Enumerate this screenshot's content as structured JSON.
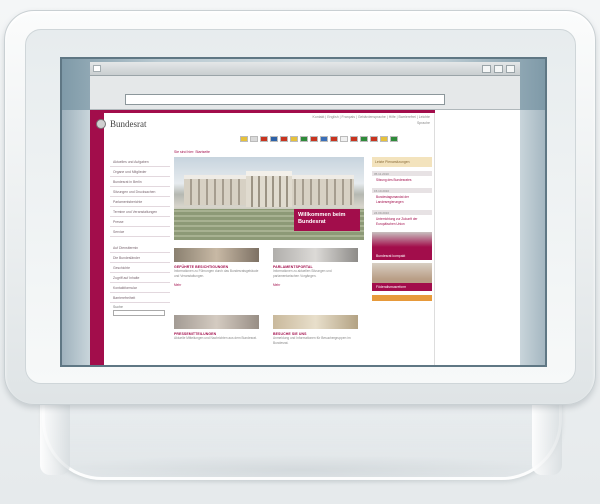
{
  "site": {
    "logo_text": "Bundesrat",
    "top_links": "Kontakt | English | Français | Gebärdensprache | Hilfe | Barrierefrei | Leichte Sprache",
    "breadcrumb": "Sie sind hier: Startseite",
    "nav_items": [
      "Aktuelles und Aufgaben",
      "Organe und Mitglieder",
      "Bundesrat in Berlin",
      "Sitzungen und Drucksachen",
      "Parlamentsberichte",
      "Termine und Veranstaltungen",
      "Presse",
      "Service"
    ],
    "nav_items_2": [
      "Auf Diensttermin",
      "Die Bundesländer",
      "Geschichte",
      "Zugriff auf Inhalte",
      "Kontaktformular",
      "Barrierefreiheit"
    ],
    "search_label": "Suche",
    "hero_caption": "Willkommen beim Bundesrat",
    "teasers": [
      {
        "title": "GEFÜHRTE BESICHTIGUNGEN",
        "text": "Informationen zu Führungen durch das Bundesratsgebäude und Veranstaltungen.",
        "more": "Mehr"
      },
      {
        "title": "PARLAMENTSPORTAL",
        "text": "Informationen zu aktuellen Sitzungen und parlamentarischen Vorgängen.",
        "more": "Mehr"
      },
      {
        "title": "PRESSEMITTEILUNGEN",
        "text": "Aktuelle Mitteilungen und Nachrichten aus dem Bundesrat.",
        "more": ""
      },
      {
        "title": "BESUCHE SIE UNS",
        "text": "Anmeldung und Informationen für Besuchergruppen im Bundesrat.",
        "more": ""
      }
    ],
    "right_head": "Letzte Plenarsitzungen",
    "right_entries": [
      {
        "date": "05.11.2010",
        "text": "Sitzung des Bundesrates"
      },
      {
        "date": "15.10.2010",
        "text": "Bundestagsmandat der Landesregierungen"
      },
      {
        "date": "24.09.2010",
        "text": "Unterrichtung zur Zukunft der Europäischen Union"
      }
    ],
    "right_labels": [
      "Bundesrat kompakt",
      "Föderalismusreform"
    ]
  },
  "colors": {
    "accent": "#a20d4b",
    "highlight": "#f3e3bd",
    "orange": "#e79a3b"
  },
  "icons": [
    "window-square-icon",
    "window-button-icon",
    "bundesadler-icon",
    "state-flag-icon"
  ]
}
